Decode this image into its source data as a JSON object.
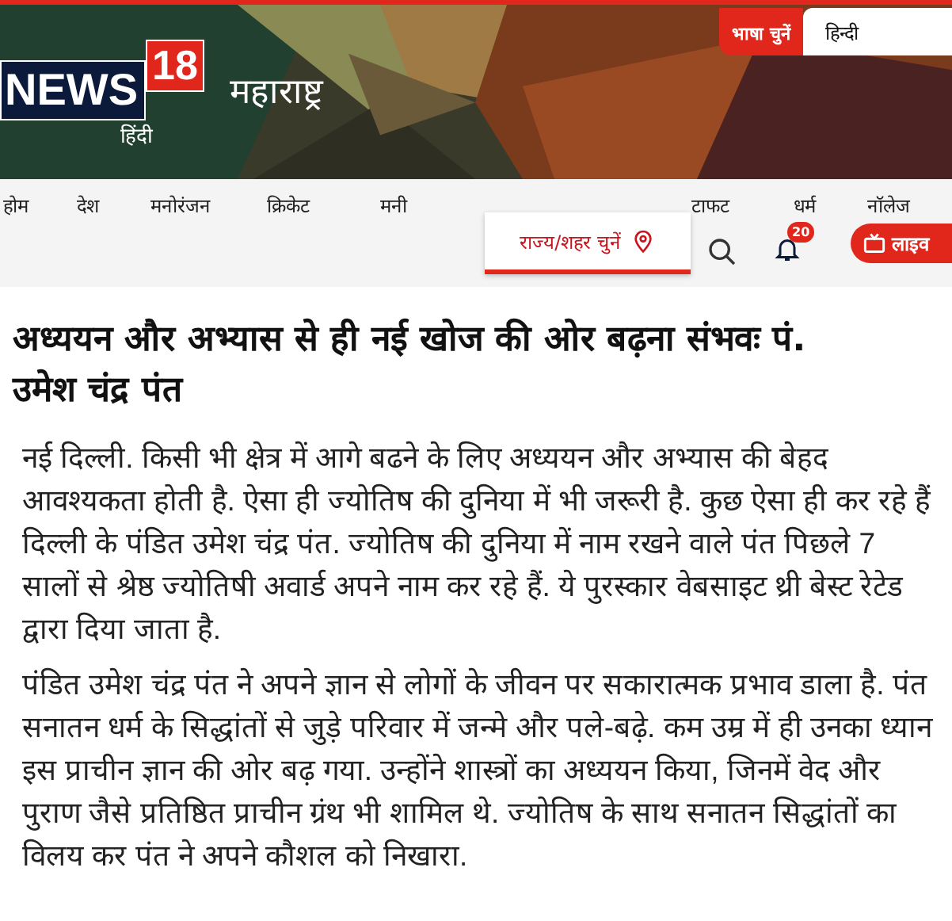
{
  "header": {
    "logo": {
      "brand": "NEWS",
      "number": "18",
      "sub": "हिंदी"
    },
    "section": "महाराष्ट्र",
    "language": {
      "label": "भाषा चुनें",
      "value": "हिन्दी"
    }
  },
  "nav": {
    "items": [
      {
        "label": "होम"
      },
      {
        "label": "देश"
      },
      {
        "label": "मनोरंजन"
      },
      {
        "label": "क्रिकेट"
      },
      {
        "label": "मनी"
      },
      {
        "label": "टाफट"
      },
      {
        "label": "धर्म"
      },
      {
        "label": "नॉलेज"
      }
    ],
    "state_picker": "राज्य/शहर चुनें",
    "notifications": "20",
    "live": "लाइव"
  },
  "article": {
    "title": "अध्ययन और अभ्यास से ही नई खोज की ओर बढ़ना संभवः पं. उमेश चंद्र पंत",
    "paragraphs": [
      "नई दिल्ली. किसी भी क्षेत्र में आगे बढने के लिए अध्ययन और अभ्यास की बेहद आवश्यकता होती है. ऐसा ही ज्योतिष की दुनिया में भी जरूरी है. कुछ ऐसा ही कर रहे हैं दिल्ली के पंडित उमेश चंद्र पंत. ज्योतिष की दुनिया में नाम रखने वाले पंत पिछले 7 सालों से श्रेष्ठ ज्योतिषी अवार्ड अपने नाम कर रहे हैं. ये पुरस्कार वेबसाइट थ्री बेस्ट रेटेड द्वारा दिया जाता है.",
      "पंडित उमेश चंद्र पंत ने अपने ज्ञान से लोगों के जीवन पर सकारात्मक प्रभाव डाला है. पंत सनातन धर्म के सिद्धांतों से जुड़े परिवार में जन्मे और पले-बढ़े. कम उम्र में ही उनका ध्यान इस प्राचीन ज्ञान की ओर बढ़ गया. उन्होंने शास्त्रों का अध्ययन किया, जिनमें वेद और पुराण जैसे प्रतिष्ठित प्राचीन ग्रंथ भी शामिल थे. ज्योतिष के साथ सनातन सिद्धांतों का विलय कर पंत ने अपने कौशल को निखारा."
    ]
  }
}
